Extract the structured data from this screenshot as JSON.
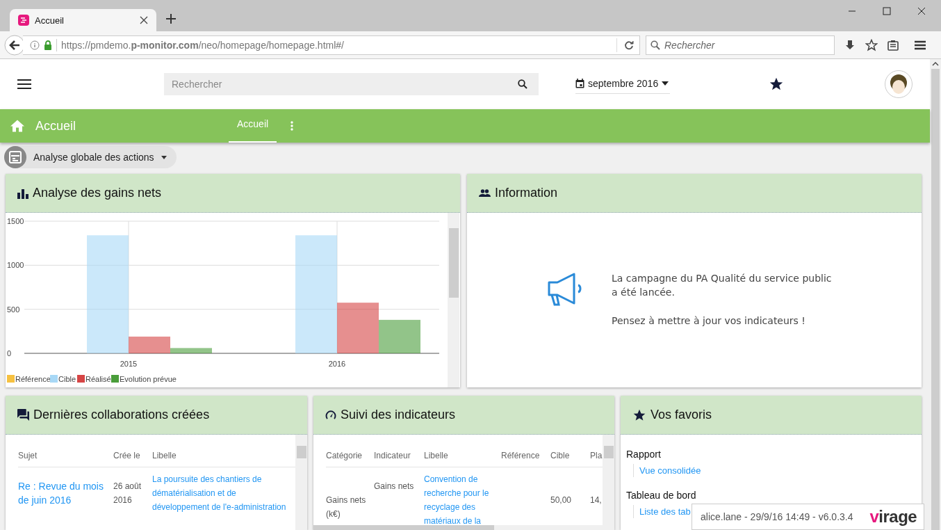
{
  "browser": {
    "tab": {
      "title": "Accueil",
      "selected": true
    },
    "url": "https://pmdemo.**p-monitor.com**/neo/homepage/homepage.html#/",
    "search": {
      "placeholder": "Rechercher"
    }
  },
  "header": {
    "search": {
      "placeholder": "Rechercher"
    },
    "date": "septembre 2016"
  },
  "app_bar": {
    "title": "Accueil",
    "tabs": [
      {
        "label": "Accueil",
        "selected": true
      }
    ]
  },
  "view_selector": "Analyse globale des actions",
  "gains": {
    "title": "Analyse des gains nets",
    "chart_data": {
      "type": "bar",
      "categories": [
        "2015",
        "2016"
      ],
      "series": [
        {
          "name": "Référence",
          "color": "#f6c141",
          "values": [
            null,
            null
          ]
        },
        {
          "name": "Cible",
          "color": "#a8d8f6",
          "values": [
            1340,
            1340
          ]
        },
        {
          "name": "Réalisé",
          "color": "#d64545",
          "values": [
            190,
            575
          ]
        },
        {
          "name": "Evolution prévue",
          "color": "#4a9d3a",
          "values": [
            60,
            380
          ]
        }
      ],
      "ylim": [
        0,
        1500
      ],
      "yticks": [
        0,
        500,
        1000,
        1500
      ],
      "grid": true,
      "legend": "bottom"
    }
  },
  "information": {
    "title": "Information",
    "paragraphs": [
      "La campagne du PA Qualité du service public a été lancée.",
      "Pensez à mettre à jour vos indicateurs !"
    ]
  },
  "collaborations": {
    "title": "Dernières collaborations créées",
    "columns": [
      "Sujet",
      "Crée le",
      "Libelle"
    ],
    "rows": [
      {
        "cells": [
          "Re : Revue du mois de juin 2016",
          "26 août 2016",
          "La poursuite des chantiers de dématérialisation et de développement de l'e-administration"
        ]
      }
    ]
  },
  "indicateurs": {
    "title": "Suivi des indicateurs",
    "columns": [
      "Catégorie",
      "Indicateur",
      "Libelle",
      "Référence",
      "Cible",
      "Pla"
    ],
    "rows": [
      {
        "cells": [
          "Gains nets (k€)",
          "Gains nets",
          "Convention de recherche pour le recyclage des matériaux de la",
          null,
          "50,00",
          "14,"
        ]
      }
    ]
  },
  "favoris": {
    "title": "Vos favoris",
    "groups": [
      {
        "label": "Rapport",
        "links": [
          "Vue consolidée"
        ]
      },
      {
        "label": "Tableau de bord",
        "links": [
          "Liste des tab"
        ]
      }
    ]
  },
  "footer": {
    "info": "alice.lane - 29/9/16 14:49 - v6.0.3.4",
    "logo": "virage"
  }
}
